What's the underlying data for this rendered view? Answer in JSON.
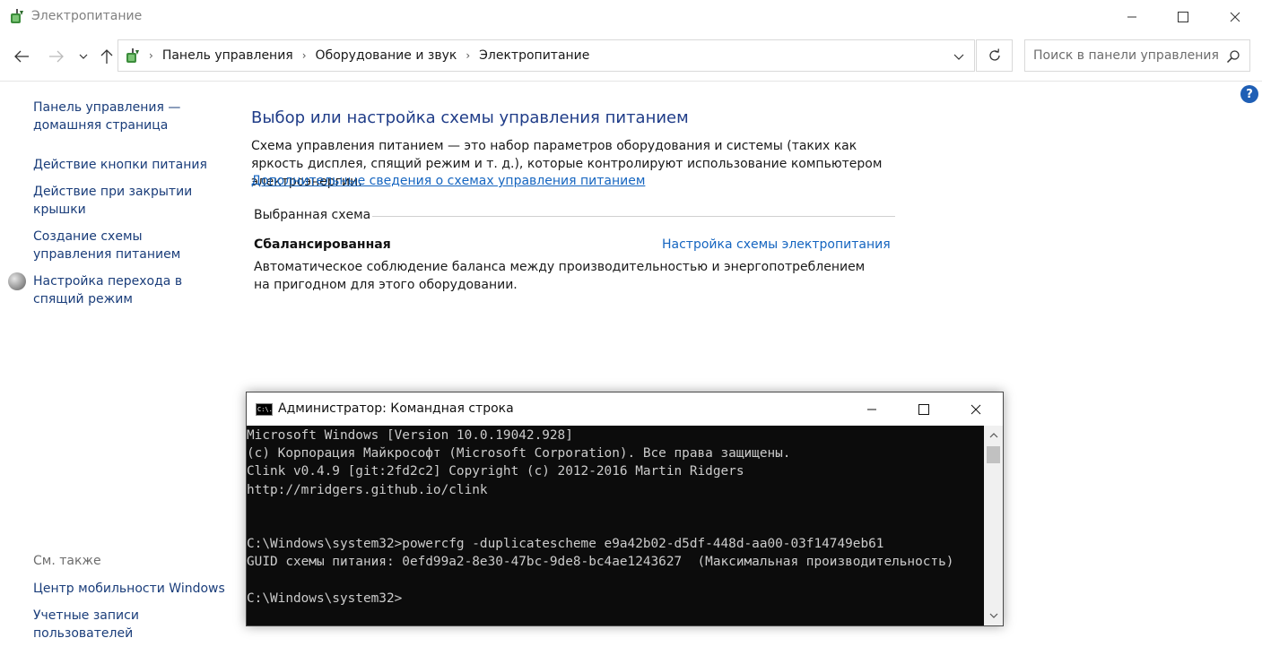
{
  "window": {
    "title": "Электропитание"
  },
  "address": {
    "crumbs": [
      "Панель управления",
      "Оборудование и звук",
      "Электропитание"
    ]
  },
  "search": {
    "placeholder": "Поиск в панели управления"
  },
  "help": {
    "glyph": "?"
  },
  "leftnav": {
    "home": "Панель управления — домашняя страница",
    "items": [
      "Действие кнопки питания",
      "Действие при закрытии крышки",
      "Создание схемы управления питанием",
      "Настройка перехода в спящий режим"
    ],
    "see_also_label": "См. также",
    "see_also": [
      "Центр мобильности Windows",
      "Учетные записи пользователей"
    ]
  },
  "main": {
    "title": "Выбор или настройка схемы управления питанием",
    "description": "Схема управления питанием — это набор параметров оборудования и системы (таких как яркость дисплея, спящий режим и т. д.), которые контролируют использование компьютером электроэнергии.",
    "more_link": "Дополнительные сведения о схемах управления питанием",
    "scheme_header": "Выбранная схема",
    "scheme_name": "Сбалансированная",
    "scheme_settings_link": "Настройка схемы электропитания",
    "scheme_description": "Автоматическое соблюдение баланса между производительностью и энергопотреблением на пригодном для этого оборудовании."
  },
  "cmd": {
    "title": "Администратор: Командная строка",
    "icon_text": "C:\\.",
    "lines": [
      "Microsoft Windows [Version 10.0.19042.928]",
      "(c) Корпорация Майкрософт (Microsoft Corporation). Все права защищены.",
      "Clink v0.4.9 [git:2fd2c2] Copyright (c) 2012-2016 Martin Ridgers",
      "http://mridgers.github.io/clink",
      "",
      "",
      "C:\\Windows\\system32>powercfg -duplicatescheme e9a42b02-d5df-448d-aa00-03f14749eb61",
      "GUID схемы питания: 0efd99a2-8e30-47bc-9de8-bc4ae1243627  (Максимальная производительность)",
      "",
      "C:\\Windows\\system32>"
    ]
  },
  "colors": {
    "link": "#1565c0",
    "heading": "#1f3c88",
    "console_bg": "#0c0c0c",
    "console_fg": "#cccccc"
  }
}
